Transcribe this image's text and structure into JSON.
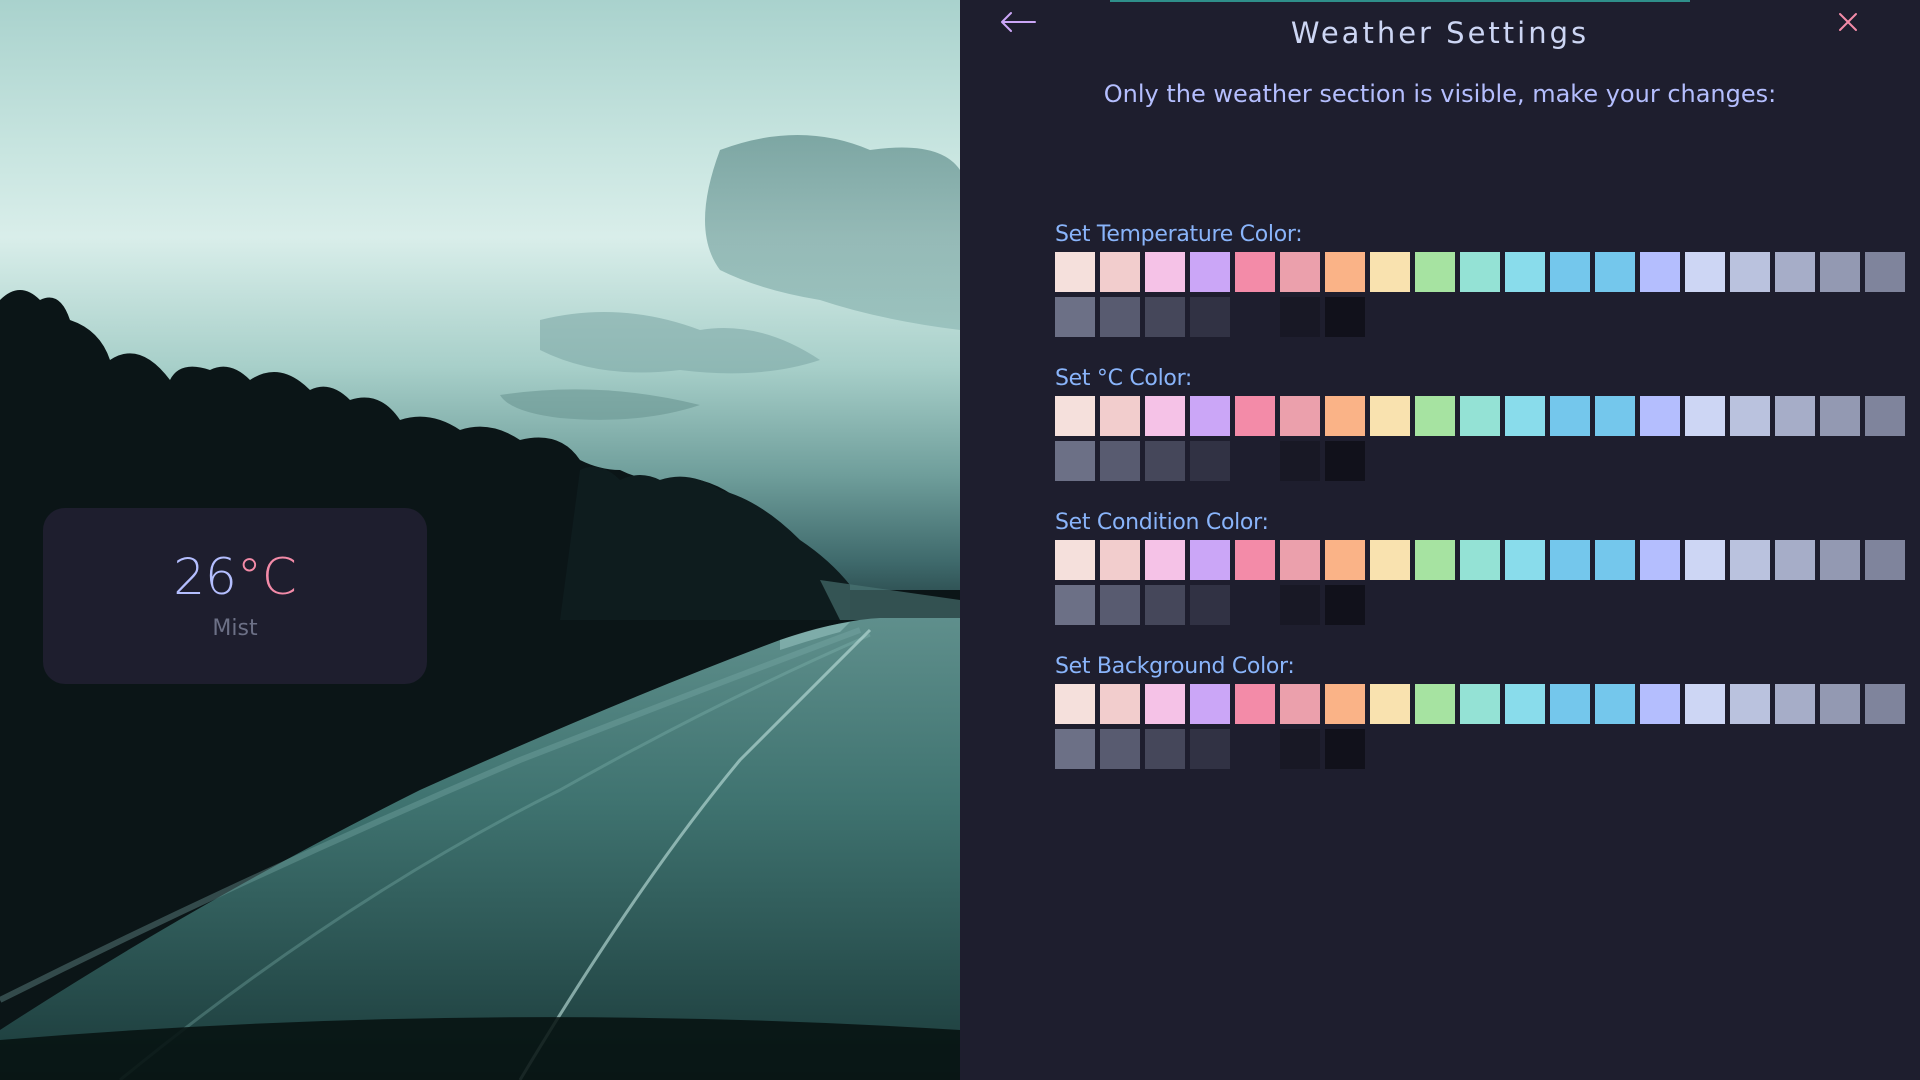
{
  "widget": {
    "temperature": "26",
    "unit": "°C",
    "condition": "Mist",
    "colors": {
      "temperature": "#b4befe",
      "unit": "#f38ba8",
      "condition": "#6c7086",
      "background": "#1e1e2e"
    }
  },
  "panel": {
    "back_icon": "arrow-left-icon",
    "close_icon": "close-icon",
    "title": "Weather Settings",
    "subtitle": "Only the weather section is visible, make your changes:",
    "sections": [
      {
        "label": "Set Temperature Color:"
      },
      {
        "label": "Set °C Color:"
      },
      {
        "label": "Set Condition Color:"
      },
      {
        "label": "Set Background Color:"
      }
    ],
    "palette": [
      "#f5e0dc",
      "#f2cdcd",
      "#f5c2e7",
      "#cba6f7",
      "#f38ba8",
      "#eba0ac",
      "#fab387",
      "#f9e2af",
      "#a6e3a1",
      "#94e2d5",
      "#89dceb",
      "#74c7ec",
      "#74c7ec",
      "#b4befe",
      "#cdd6f4",
      "#bac2de",
      "#a6adc8",
      "#9399b2",
      "#7f849c",
      "#6c7086",
      "#585b70",
      "#45475a",
      "#313244",
      "#1e1e2e",
      "#181825",
      "#11111b"
    ],
    "accent_colors": {
      "icons": "#cba6f7",
      "close": "#f38ba8",
      "title": "#cdd6f4",
      "subtitle": "#b4befe",
      "labels": "#89b4fa"
    }
  }
}
